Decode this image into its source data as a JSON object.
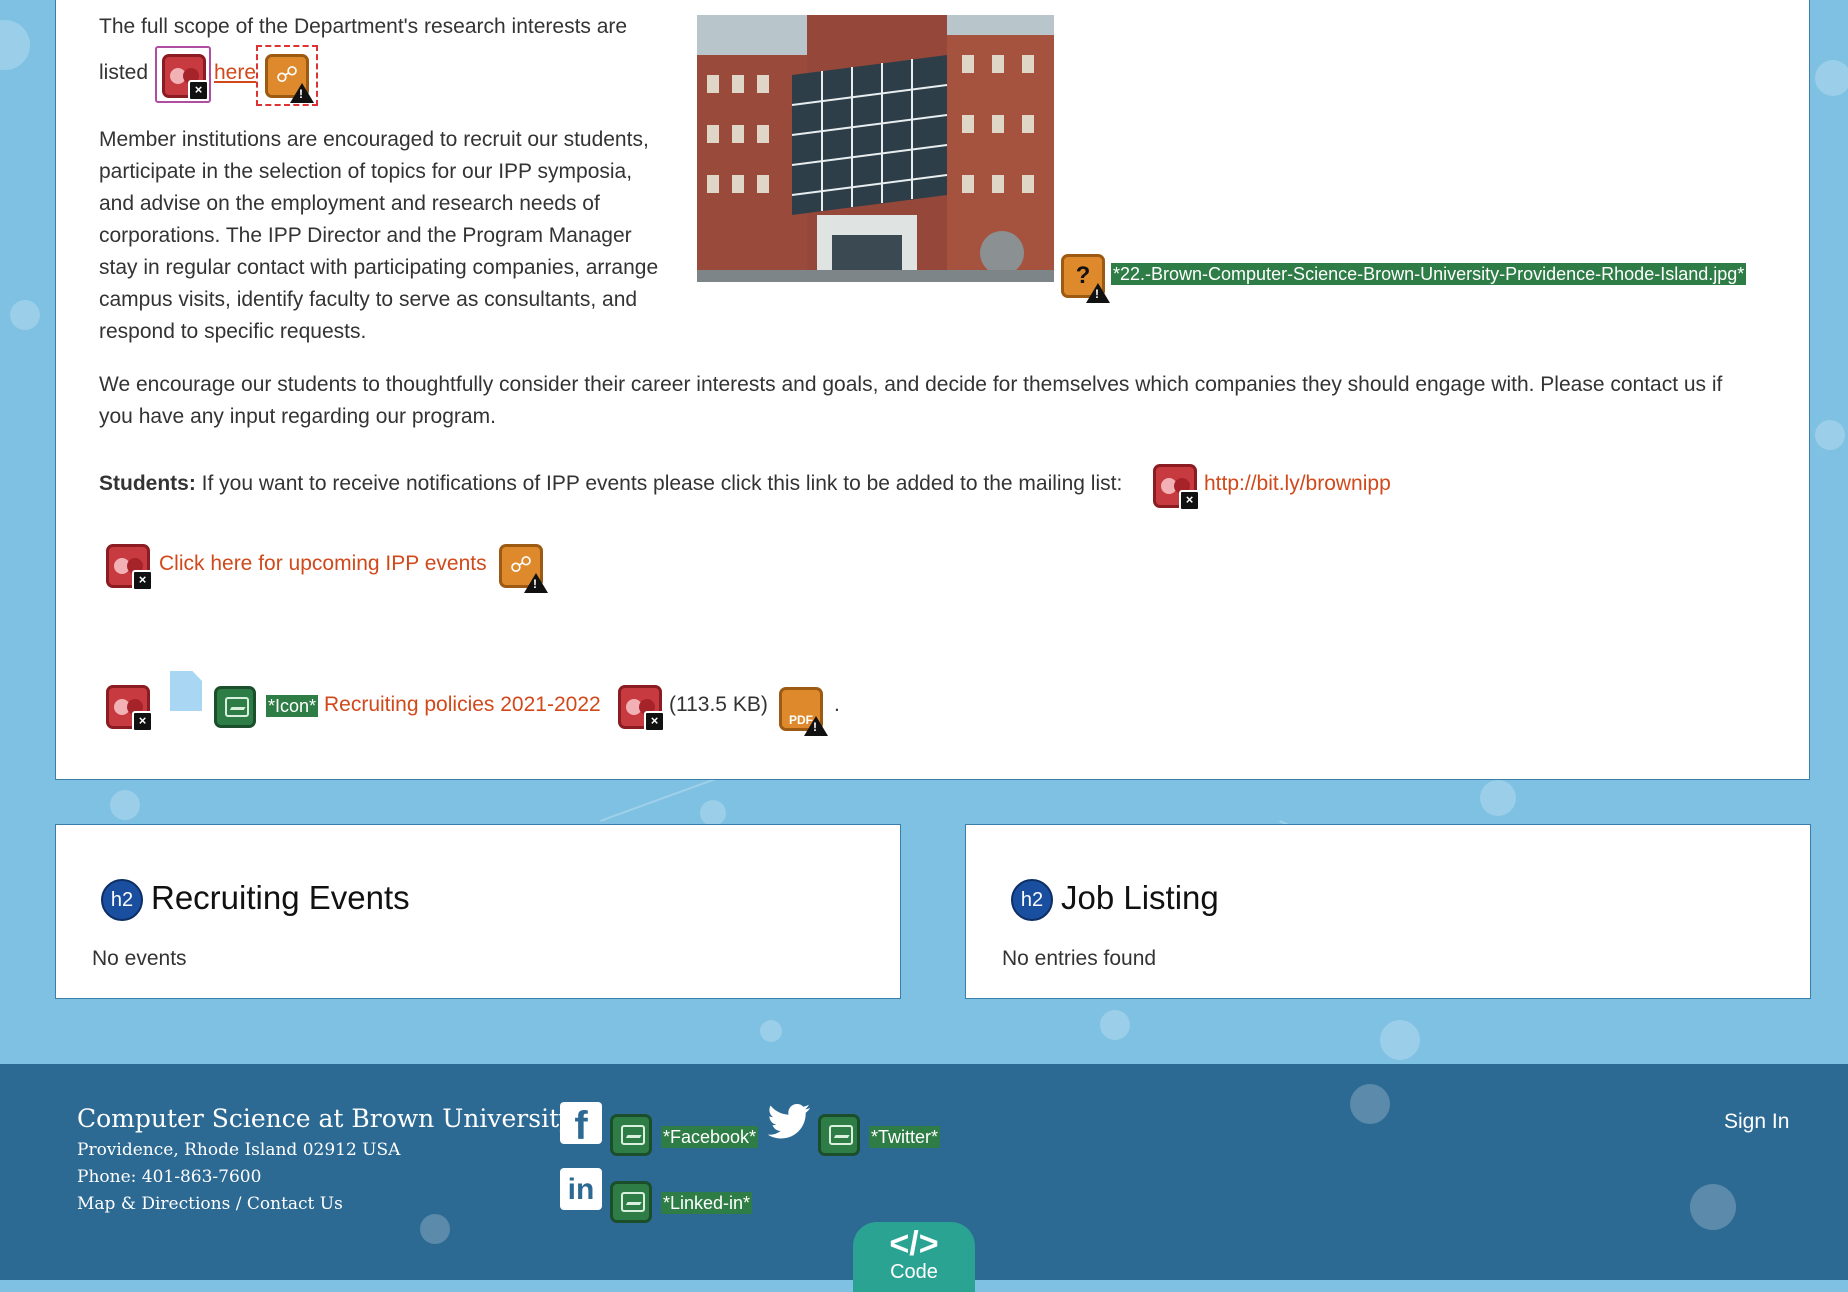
{
  "intro": {
    "line1": "The full scope of the Department's research interests are",
    "listed": "listed",
    "here_link": "here"
  },
  "member_paragraph": [
    "Member institutions are encouraged to recruit our students,",
    "participate in the selection of topics for our IPP symposia,",
    "and advise on the employment and research needs of",
    "corporations. The IPP Director and the Program Manager",
    "stay in regular contact with participating companies, arrange",
    "campus visits, identify faculty to serve as consultants, and",
    "respond to specific requests."
  ],
  "image_caption": "*22.-Brown-Computer-Science-Brown-University-Providence-Rhode-Island.jpg*",
  "encourage_paragraph": [
    "We encourage our students to thoughtfully consider their career interests and goals, and decide for themselves which companies they should engage with. Please contact us if",
    "you have any input regarding our program."
  ],
  "students": {
    "label": "Students:",
    "text": "If you want to receive notifications of IPP events please click this link to be added to the mailing list:",
    "link": "http://bit.ly/brownipp"
  },
  "upcoming_link": "Click here for upcoming IPP events",
  "policies": {
    "icon_tag": "*Icon*",
    "link": "Recruiting policies 2021-2022",
    "size": "(113.5 KB)",
    "pdf_label": "PDF",
    "period": "."
  },
  "events_card": {
    "badge": "h2",
    "title": "Recruiting Events",
    "empty": "No events"
  },
  "jobs_card": {
    "badge": "h2",
    "title": "Job Listing",
    "empty": "No entries found"
  },
  "footer": {
    "org": "Computer Science at Brown University",
    "address": "Providence, Rhode Island 02912 USA",
    "phone": "Phone: 401-863-7600",
    "map": "Map & Directions",
    "sep": " / ",
    "contact": "Contact Us",
    "signin": "Sign In",
    "facebook_tag": "*Facebook*",
    "twitter_tag": "*Twitter*",
    "linkedin_tag": "*Linked-in*"
  },
  "code_tab": {
    "glyph": "</>",
    "label": "Code"
  },
  "colors": {
    "link": "#d1491b",
    "footer_bg": "#2d6a93",
    "page_bg": "#7fc1e2",
    "code_tab": "#2aa392"
  },
  "icons": [
    "waveform-error-icon",
    "broken-link-icon",
    "alt-image-icon",
    "unknown-alt-icon",
    "pdf-icon",
    "file-icon",
    "h2-heading-icon",
    "facebook-icon",
    "twitter-icon",
    "linkedin-icon",
    "code-icon"
  ]
}
